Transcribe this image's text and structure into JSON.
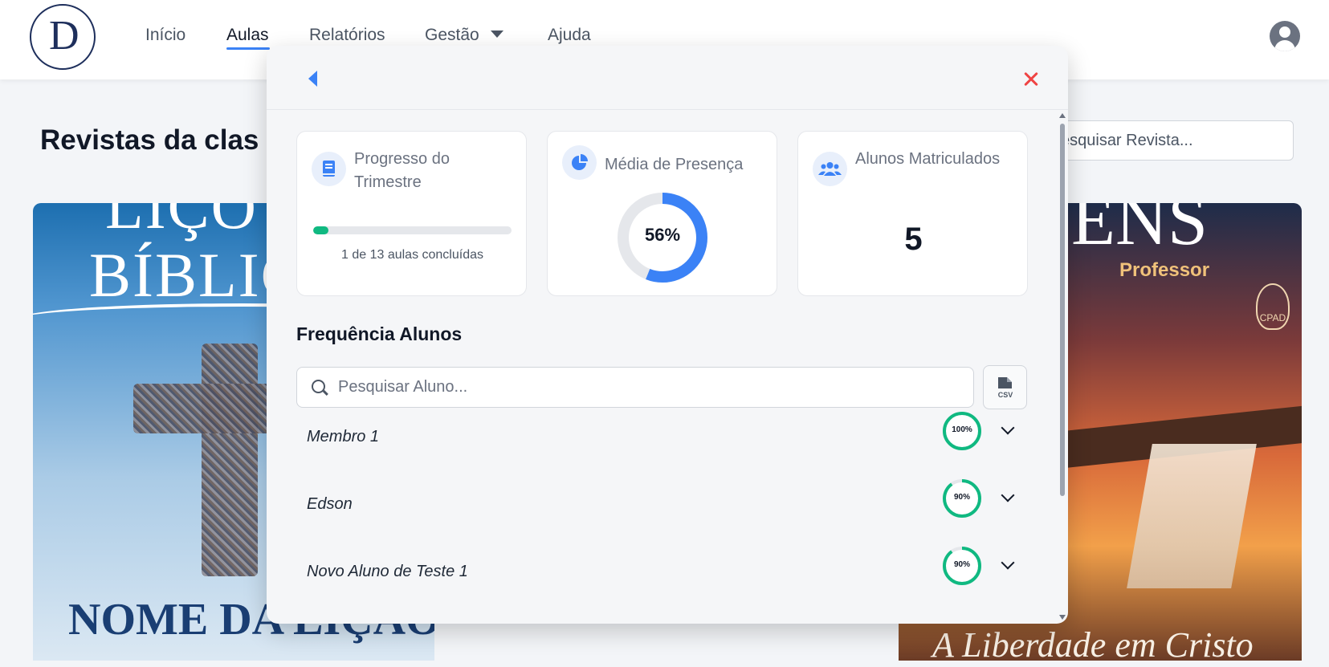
{
  "nav": {
    "items": [
      "Início",
      "Aulas",
      "Relatórios",
      "Gestão",
      "Ajuda"
    ],
    "active": "Aulas"
  },
  "page": {
    "title": "Revistas da clas",
    "search_placeholder": "esquisar Revista..."
  },
  "covers": {
    "left": {
      "line1": "LIÇÕ",
      "line2": "BÍBLIC",
      "lesson_name": "NOME DA LIÇÃO"
    },
    "right": {
      "title": "VENS",
      "subtitle": "Professor",
      "publisher": "CPAD",
      "tagline": "A Liberdade em Cristo"
    }
  },
  "modal": {
    "cards": {
      "progress": {
        "label": "Progresso do Trimestre",
        "completed": 1,
        "total": 13,
        "text": "1 de 13 aulas concluídas"
      },
      "attendance": {
        "label": "Média de Presença",
        "value": 56,
        "value_text": "56%"
      },
      "enrolled": {
        "label": "Alunos Matriculados",
        "value": "5"
      }
    },
    "section_title": "Frequência Alunos",
    "student_search_placeholder": "Pesquisar Aluno...",
    "csv_label": "CSV",
    "students": [
      {
        "name": "Membro 1",
        "pct": 100,
        "pct_text": "100%"
      },
      {
        "name": "Edson",
        "pct": 90,
        "pct_text": "90%"
      },
      {
        "name": "Novo Aluno de Teste 1",
        "pct": 90,
        "pct_text": "90%"
      }
    ]
  },
  "colors": {
    "accent": "#3b82f6",
    "success": "#10b981",
    "danger": "#ef4444",
    "track": "#e5e7eb"
  },
  "icons": {
    "back": "caret-left-icon",
    "close": "close-icon",
    "progress": "book-icon",
    "attendance": "pie-chart-icon",
    "enrolled": "users-icon",
    "search": "search-icon",
    "csv": "csv-file-icon",
    "expand": "chevron-down-icon",
    "user": "user-circle-icon"
  }
}
